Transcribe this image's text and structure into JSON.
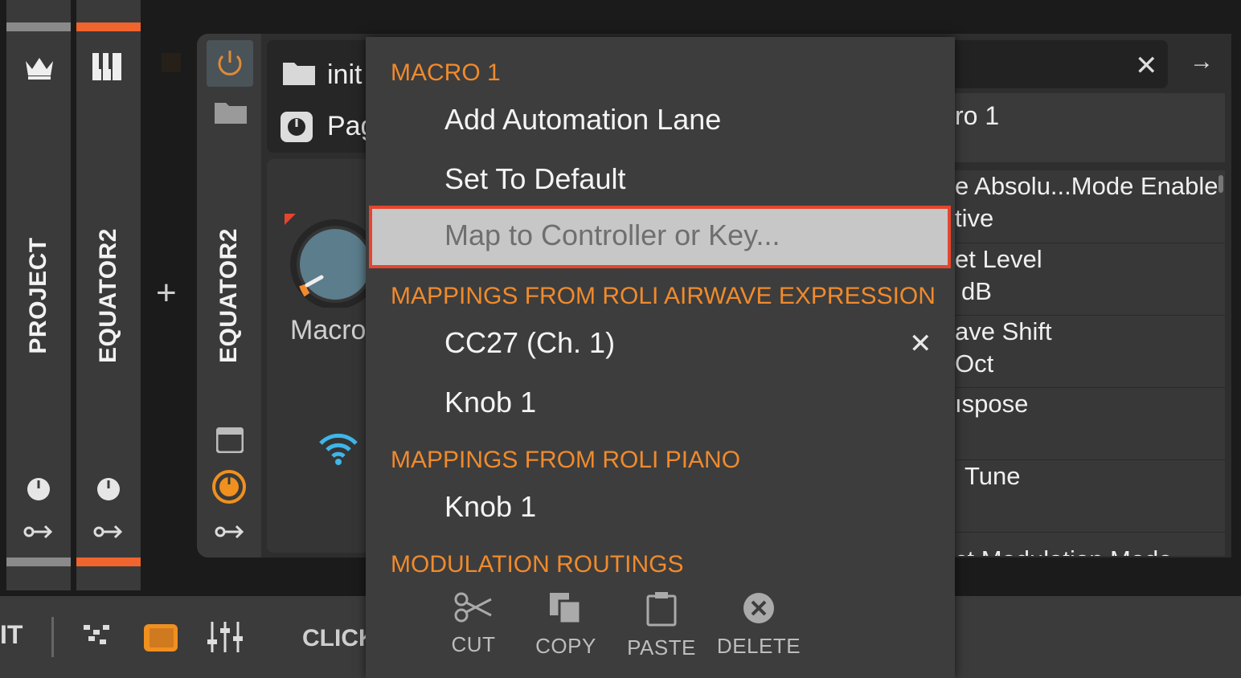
{
  "tracks": [
    {
      "label": "PROJECT",
      "accent": "#8a8a8a",
      "icon": "crown-icon"
    },
    {
      "label": "EQUATOR2",
      "accent": "#f0642d",
      "icon": "piano-icon"
    }
  ],
  "add_glyph": "+",
  "device": {
    "name": "EQUATOR2",
    "preset_name": "init",
    "page_label": "Pag",
    "macro_label": "Macro"
  },
  "right_panel": {
    "close_glyph": "✕",
    "arrow_glyph": "→",
    "title": "ro 1",
    "items": [
      {
        "line1": "e Absolu...Mode Enable",
        "line2": "tive"
      },
      {
        "line1": "et Level",
        "line2": "dB"
      },
      {
        "line1": "ave Shift",
        "line2": "Oct"
      },
      {
        "line1": "ıspose",
        "line2": ""
      },
      {
        "line1": "Tune",
        "line2": ""
      },
      {
        "line1": "ct Modulation Mode",
        "line2": ""
      }
    ]
  },
  "toolbar": {
    "left_text": "IT",
    "click_text": "CLICK"
  },
  "menu": {
    "macro_header": "MACRO 1",
    "add_automation": "Add Automation Lane",
    "set_default": "Set To Default",
    "map_controller": "Map to Controller or Key...",
    "airwave_header": "MAPPINGS FROM ROLI AIRWAVE EXPRESSION",
    "airwave_items": [
      "CC27 (Ch. 1)",
      "Knob 1"
    ],
    "remove_glyph": "✕",
    "piano_header": "MAPPINGS FROM ROLI PIANO",
    "piano_items": [
      "Knob 1"
    ],
    "modulation_header": "MODULATION ROUTINGS",
    "edit": {
      "cut": "CUT",
      "copy": "COPY",
      "paste": "PASTE",
      "delete": "DELETE"
    }
  },
  "colors": {
    "accent_orange": "#f08a2c",
    "highlight_border": "#e5452e",
    "wifi_blue": "#3fb6e8"
  }
}
